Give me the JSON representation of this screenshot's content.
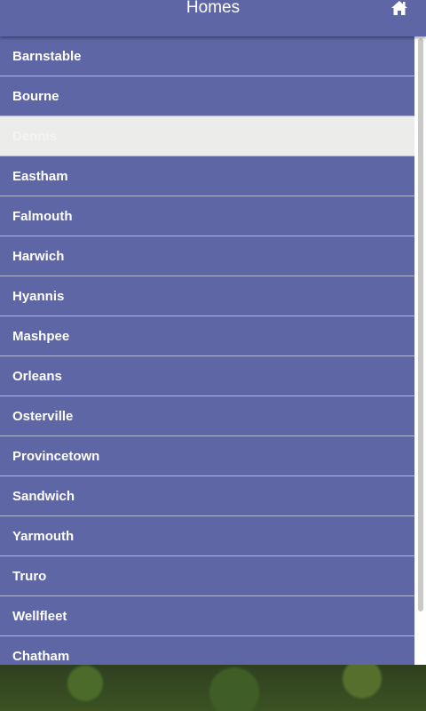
{
  "header": {
    "title": "Homes",
    "home_icon": "home-icon"
  },
  "colors": {
    "header_bg": "#5e66a6",
    "item_bg": "#5e66a6",
    "item_text": "#ffffff",
    "selected_bg": "#ececea"
  },
  "towns": [
    "Barnstable",
    "Bourne",
    "Dennis",
    "Eastham",
    "Falmouth",
    "Harwich",
    "Hyannis",
    "Mashpee",
    "Orleans",
    "Osterville",
    "Provincetown",
    "Sandwich",
    "Yarmouth",
    "Truro",
    "Wellfleet",
    "Chatham"
  ],
  "selected_index": 2
}
